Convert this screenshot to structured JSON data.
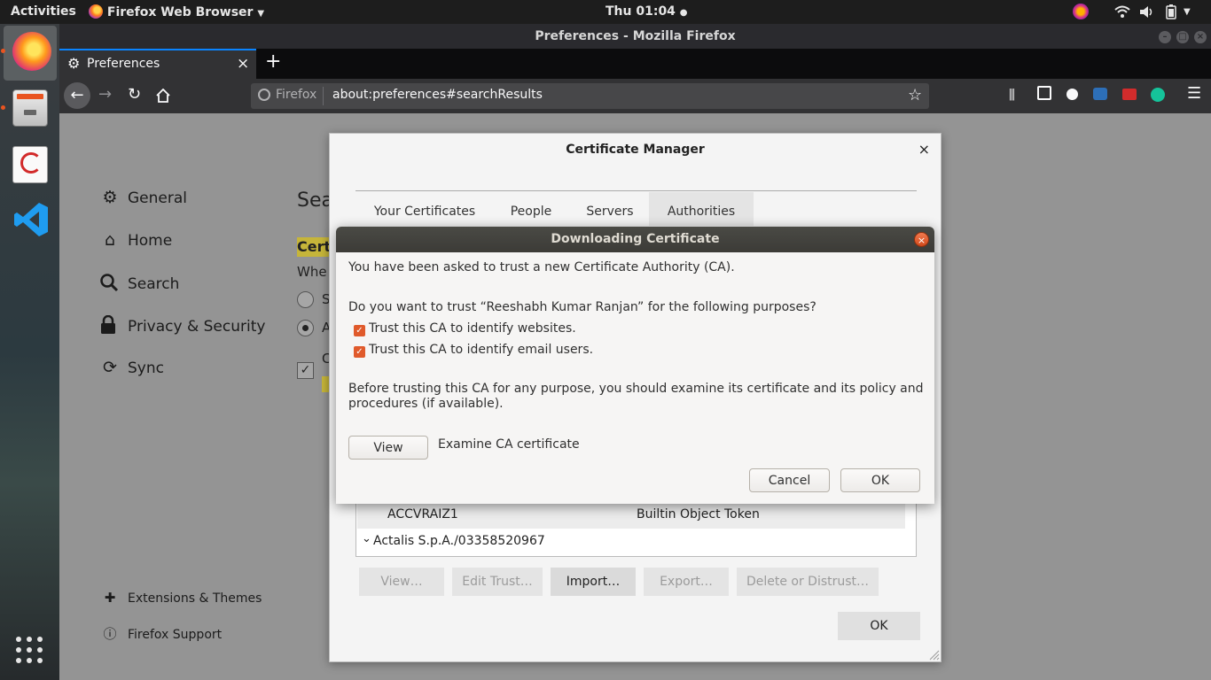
{
  "topbar": {
    "activities": "Activities",
    "app_name": "Firefox Web Browser",
    "clock": "Thu 01:04"
  },
  "window": {
    "title": "Preferences - Mozilla Firefox"
  },
  "tab": {
    "label": "Preferences",
    "close": "×",
    "new_tab": "+"
  },
  "urlbar": {
    "identity_label": "Firefox",
    "url": "about:preferences#searchResults"
  },
  "prefs": {
    "categories": [
      "General",
      "Home",
      "Search",
      "Privacy & Security",
      "Sync"
    ],
    "footer_links": [
      "Extensions & Themes",
      "Firefox Support"
    ],
    "partial_texts": [
      "Sea",
      "Cert",
      "Whe",
      "S",
      "A",
      "C"
    ]
  },
  "cert_manager": {
    "title": "Certificate Manager",
    "close": "×",
    "tabs": [
      "Your Certificates",
      "People",
      "Servers",
      "Authorities"
    ],
    "selected_tab": "Authorities",
    "rows": [
      {
        "name": "ACCVRAIZ1",
        "token": "Builtin Object Token"
      },
      {
        "name": "Actalis S.p.A./03358520967",
        "token": ""
      }
    ],
    "row_expander": "⌄",
    "buttons": [
      "View…",
      "Edit Trust…",
      "Import…",
      "Export…",
      "Delete or Distrust…"
    ],
    "ok": "OK"
  },
  "download_cert": {
    "title": "Downloading Certificate",
    "close": "×",
    "line1": "You have been asked to trust a new Certificate Authority (CA).",
    "question": "Do you want to trust “Reeshabh Kumar Ranjan” for the following purposes?",
    "option_websites": "Trust this CA to identify websites.",
    "option_email": "Trust this CA to identify email users.",
    "option_websites_checked": true,
    "option_email_checked": true,
    "advice_line1": "Before trusting this CA for any purpose, you should examine its certificate and its policy and",
    "advice_line2": "procedures (if available).",
    "view_button": "View",
    "examine_label": "Examine CA certificate",
    "cancel_button": "Cancel",
    "ok_button": "OK"
  },
  "colors": {
    "accent_orange": "#e05a2b",
    "tab_highlight": "#0a84ff"
  }
}
